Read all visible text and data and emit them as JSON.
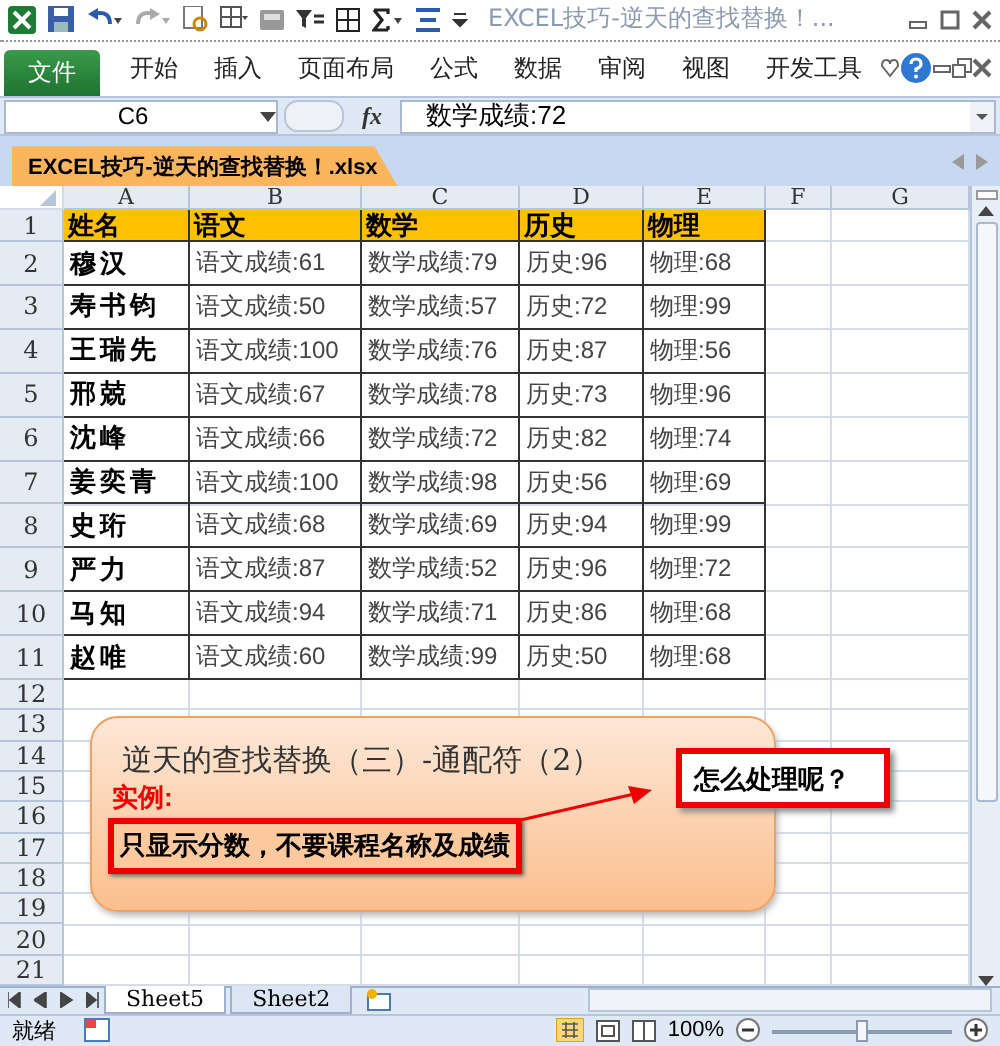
{
  "window": {
    "title": "EXCEL技巧-逆天的查找替换！..."
  },
  "ribbon": {
    "tabs": [
      {
        "label": "文件",
        "kind": "file"
      },
      {
        "label": "开始",
        "kind": "tab"
      },
      {
        "label": "插入",
        "kind": "tab"
      },
      {
        "label": "页面布局",
        "kind": "tab"
      },
      {
        "label": "公式",
        "kind": "tab"
      },
      {
        "label": "数据",
        "kind": "tab"
      },
      {
        "label": "审阅",
        "kind": "tab"
      },
      {
        "label": "视图",
        "kind": "tab"
      },
      {
        "label": "开发工具",
        "kind": "tab"
      }
    ]
  },
  "formula_bar": {
    "name_box": "C6",
    "fx_label": "fx",
    "formula": "数学成绩:72"
  },
  "workbook_tab": {
    "title": "EXCEL技巧-逆天的查找替换！.xlsx"
  },
  "sheet": {
    "columns": [
      "A",
      "B",
      "C",
      "D",
      "E",
      "F",
      "G"
    ],
    "row_numbers": [
      "1",
      "2",
      "3",
      "4",
      "5",
      "6",
      "7",
      "8",
      "9",
      "10",
      "11",
      "12",
      "13",
      "14",
      "15",
      "16",
      "17",
      "18",
      "19",
      "20",
      "21"
    ],
    "header_row": [
      "姓名",
      "语文",
      "数学",
      "历史",
      "物理"
    ],
    "rows": [
      [
        "穆汉",
        "语文成绩:61",
        "数学成绩:79",
        "历史:96",
        "物理:68"
      ],
      [
        "寿书钧",
        "语文成绩:50",
        "数学成绩:57",
        "历史:72",
        "物理:99"
      ],
      [
        "王瑞先",
        "语文成绩:100",
        "数学成绩:76",
        "历史:87",
        "物理:56"
      ],
      [
        "邢兢",
        "语文成绩:67",
        "数学成绩:78",
        "历史:73",
        "物理:96"
      ],
      [
        "沈峰",
        "语文成绩:66",
        "数学成绩:72",
        "历史:82",
        "物理:74"
      ],
      [
        "姜奕青",
        "语文成绩:100",
        "数学成绩:98",
        "历史:56",
        "物理:69"
      ],
      [
        "史珩",
        "语文成绩:68",
        "数学成绩:69",
        "历史:94",
        "物理:99"
      ],
      [
        "严力",
        "语文成绩:87",
        "数学成绩:52",
        "历史:96",
        "物理:72"
      ],
      [
        "马知",
        "语文成绩:94",
        "数学成绩:71",
        "历史:86",
        "物理:68"
      ],
      [
        "赵唯",
        "语文成绩:60",
        "数学成绩:99",
        "历史:50",
        "物理:68"
      ]
    ]
  },
  "shapes": {
    "title": "逆天的查找替换（三）-通配符（2）",
    "label": "实例:",
    "instruction": "只显示分数，不要课程名称及成绩",
    "callout": "怎么处理呢？"
  },
  "sheet_tabs": [
    {
      "label": "Sheet5",
      "selected": true
    },
    {
      "label": "Sheet2",
      "selected": false
    }
  ],
  "status_bar": {
    "status": "就绪",
    "zoom": "100%",
    "zoom_slider": {
      "level": 0.5
    }
  }
}
